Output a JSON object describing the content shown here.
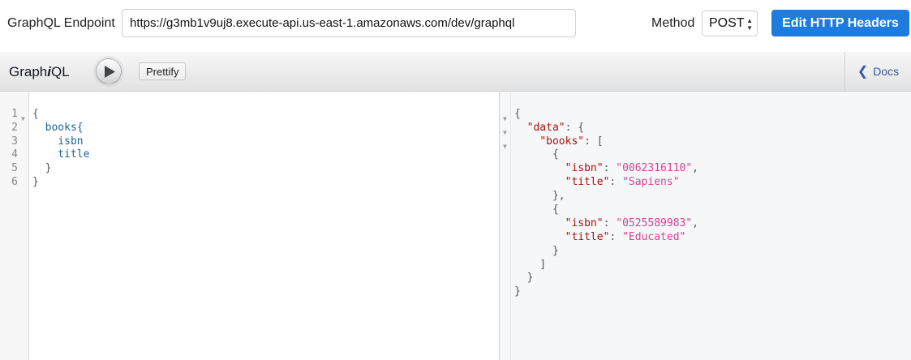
{
  "endpoint": {
    "label": "GraphQL Endpoint",
    "url": "https://g3mb1v9uj8.execute-api.us-east-1.amazonaws.com/dev/graphql"
  },
  "method": {
    "label": "Method",
    "value": "POST"
  },
  "edit_headers_label": "Edit HTTP Headers",
  "toolbar": {
    "title_prefix": "Graph",
    "title_italic": "i",
    "title_suffix": "QL",
    "prettify_label": "Prettify",
    "docs_label": "Docs"
  },
  "query": {
    "line_numbers": [
      "1",
      "2",
      "3",
      "4",
      "5",
      "6"
    ],
    "lines": [
      "{",
      "  books{",
      "    isbn",
      "    title",
      "  }",
      "}"
    ]
  },
  "result": {
    "lines": [
      "{",
      "  \"data\": {",
      "    \"books\": [",
      "      {",
      "        \"isbn\": \"0062316110\",",
      "        \"title\": \"Sapiens\"",
      "      },",
      "      {",
      "        \"isbn\": \"0525589983\",",
      "        \"title\": \"Educated\"",
      "      }",
      "    ]",
      "  }",
      "}"
    ],
    "tokens": {
      "data_key": "\"data\"",
      "books_key": "\"books\"",
      "isbn_key": "\"isbn\"",
      "title_key": "\"title\"",
      "isbn_1": "\"0062316110\"",
      "title_1": "\"Sapiens\"",
      "isbn_2": "\"0525589983\"",
      "title_2": "\"Educated\""
    }
  },
  "colors": {
    "primary_button": "#1e7be0",
    "json_key": "#a11",
    "json_string": "#d64292",
    "query_field": "#1f61a0"
  }
}
